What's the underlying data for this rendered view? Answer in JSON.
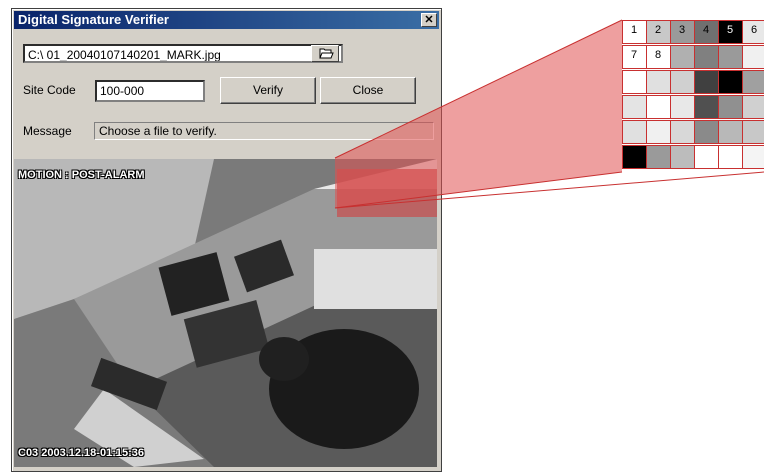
{
  "window": {
    "title": "Digital Signature Verifier",
    "close_glyph": "✕"
  },
  "file": {
    "value": "C:\\ 01_20040107140201_MARK.jpg",
    "browse_icon": "open-folder-icon"
  },
  "site_code": {
    "label": "Site Code",
    "value": "100-000"
  },
  "buttons": {
    "verify": "Verify",
    "close": "Close"
  },
  "message": {
    "label": "Message",
    "text": "Choose a file to verify."
  },
  "camera": {
    "top_overlay": "MOTION : POST-ALARM",
    "bottom_overlay": "C03 2003.12.18-01:15:36"
  },
  "grid": {
    "row1": [
      "1",
      "2",
      "3",
      "4",
      "5",
      "6"
    ],
    "row2": [
      "7",
      "8"
    ]
  },
  "colors": {
    "titlebar": "#0a246a",
    "highlight": "#e05050"
  }
}
